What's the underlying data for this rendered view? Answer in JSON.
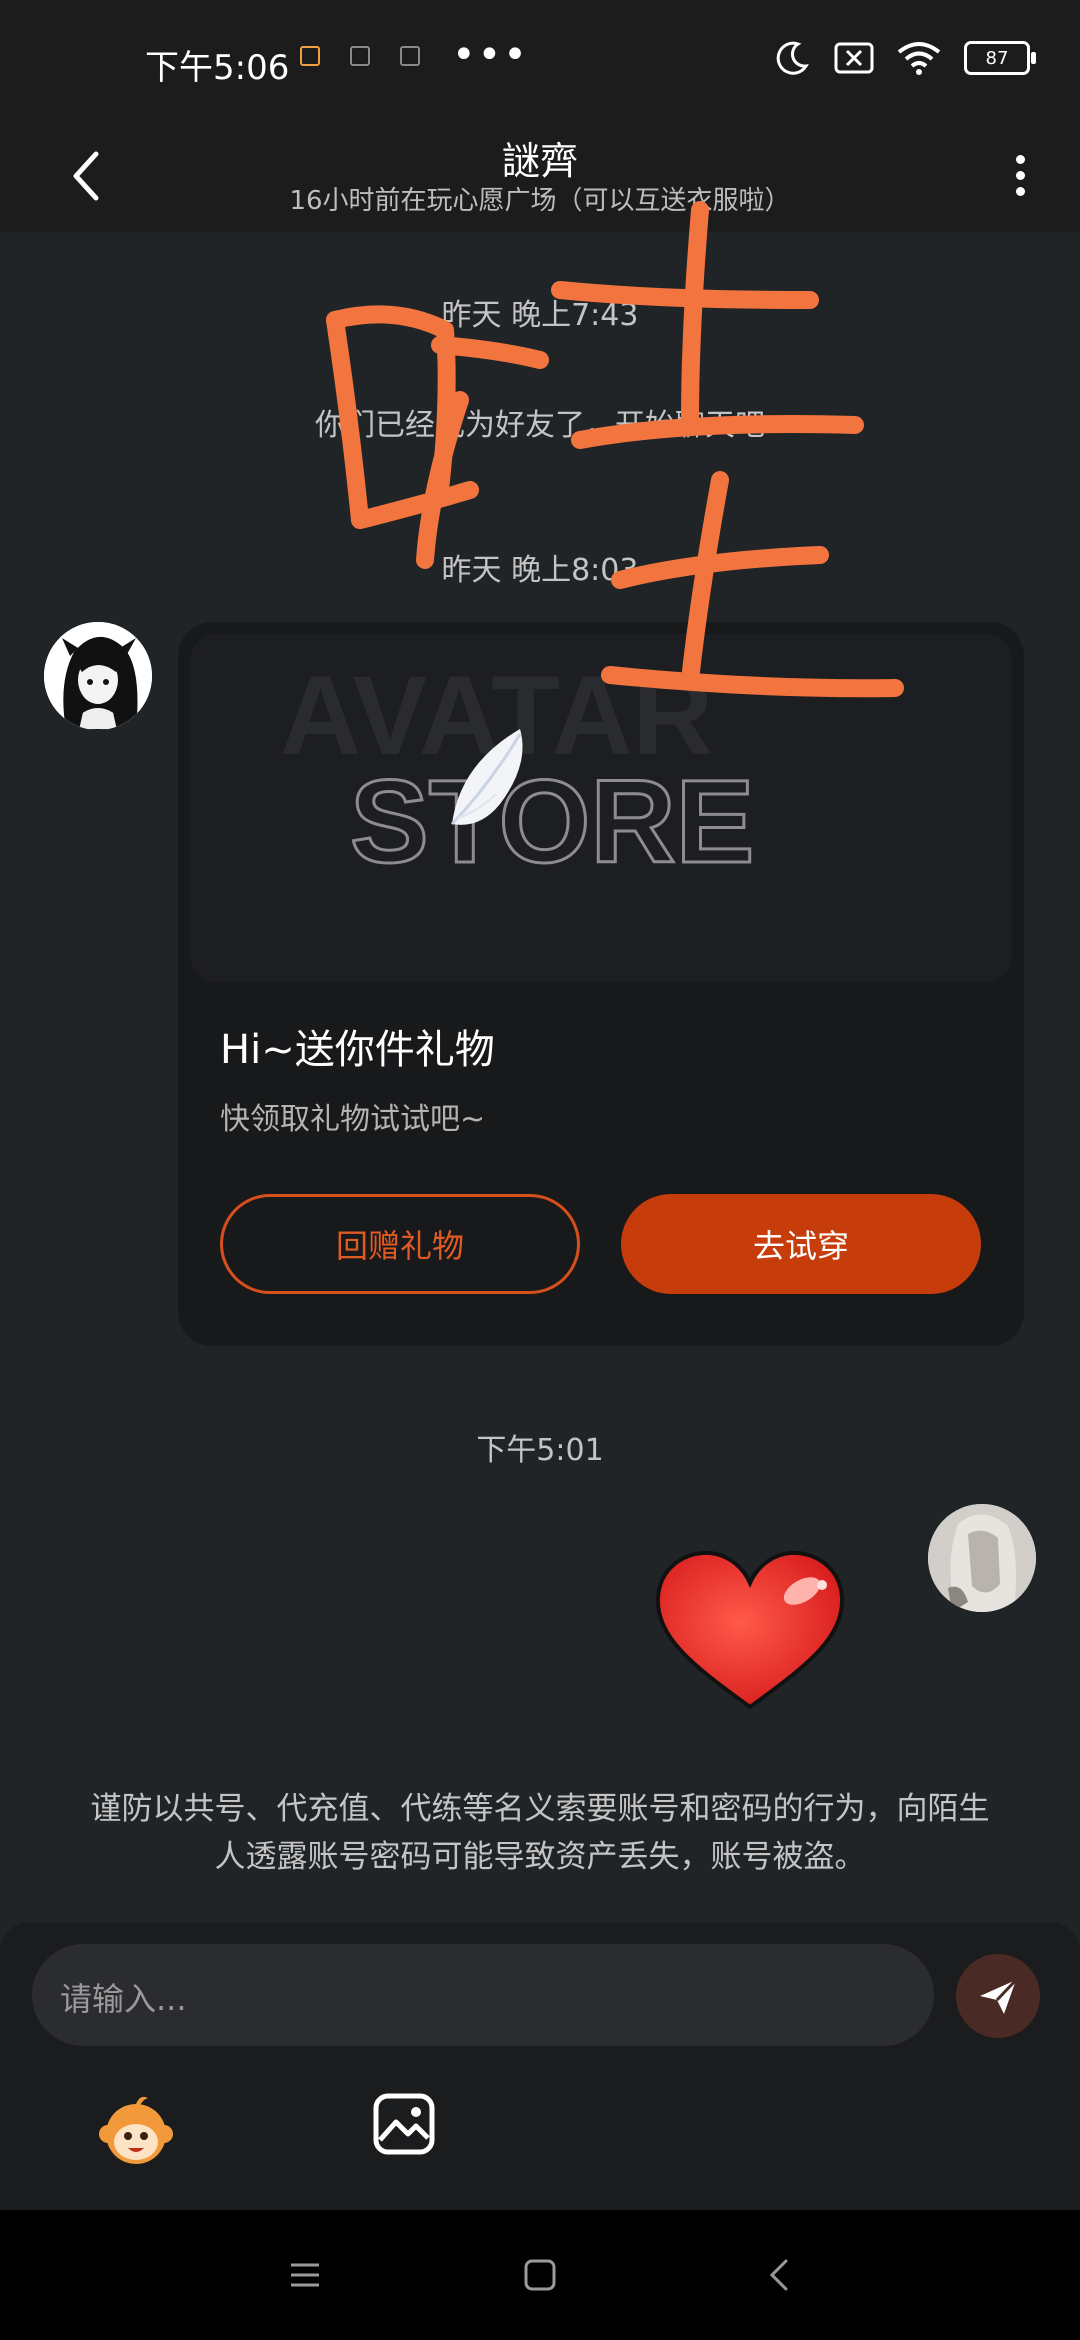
{
  "status_bar": {
    "time": "下午5:06",
    "dots": "•••",
    "battery": "87"
  },
  "header": {
    "title": "謎齊",
    "subtitle": "16小时前在玩心愿广场（可以互送衣服啦）"
  },
  "messages": {
    "ts1": "昨天 晚上7:43",
    "system_friend": "你们已经成为好友了，开始聊天吧",
    "ts2": "昨天 晚上8:03",
    "ts3": "下午5:01"
  },
  "gift_card": {
    "banner_text_1": "AVATAR",
    "banner_text_2": "STORE",
    "title": "Hi~送你件礼物",
    "subtitle": "快领取礼物试试吧~",
    "btn_return": "回赠礼物",
    "btn_try": "去试穿"
  },
  "warning": "谨防以共号、代充值、代练等名义索要账号和密码的行为，向陌生人透露账号密码可能导致资产丢失，账号被盗。",
  "input": {
    "placeholder": "请输入..."
  },
  "colors": {
    "accent": "#c63c0b",
    "accent_outline": "#d6501c",
    "scribble": "#f2743e",
    "background": "#212427"
  }
}
